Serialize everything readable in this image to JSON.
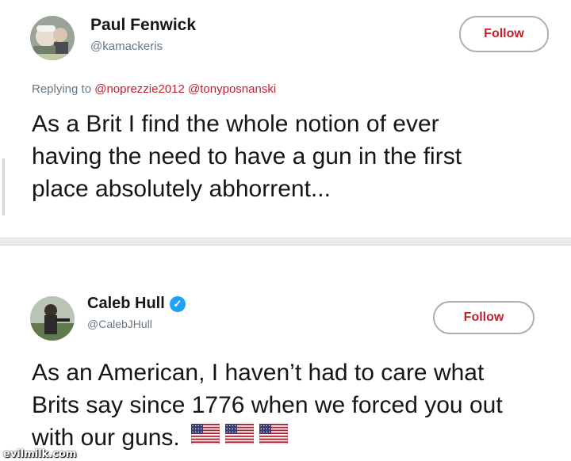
{
  "tweets": [
    {
      "display_name": "Paul Fenwick",
      "handle": "@kamackeris",
      "follow_label": "Follow",
      "reply_prefix": "Replying to",
      "reply_mentions": [
        "@noprezzie2012",
        "@tonyposnanski"
      ],
      "text_lines": [
        "As a Brit I find the whole notion of ever",
        "having the need to have a gun in the first",
        "place absolutely abhorrent..."
      ]
    },
    {
      "display_name": "Caleb Hull",
      "handle": "@CalebJHull",
      "verified": true,
      "follow_label": "Follow",
      "text_lines": [
        "As an American, I haven’t had to care what",
        "Brits say since 1776 when we forced you out",
        "with our guns."
      ],
      "emoji_count": 3,
      "emoji": "us-flag-icon"
    }
  ],
  "watermark": "evilmilk.com",
  "colors": {
    "follow_text": "#c41e2a",
    "mention": "#c41e2a",
    "verified_badge": "#1da1f2",
    "handle_gray": "#657786",
    "separator": "#e6ecf0"
  }
}
